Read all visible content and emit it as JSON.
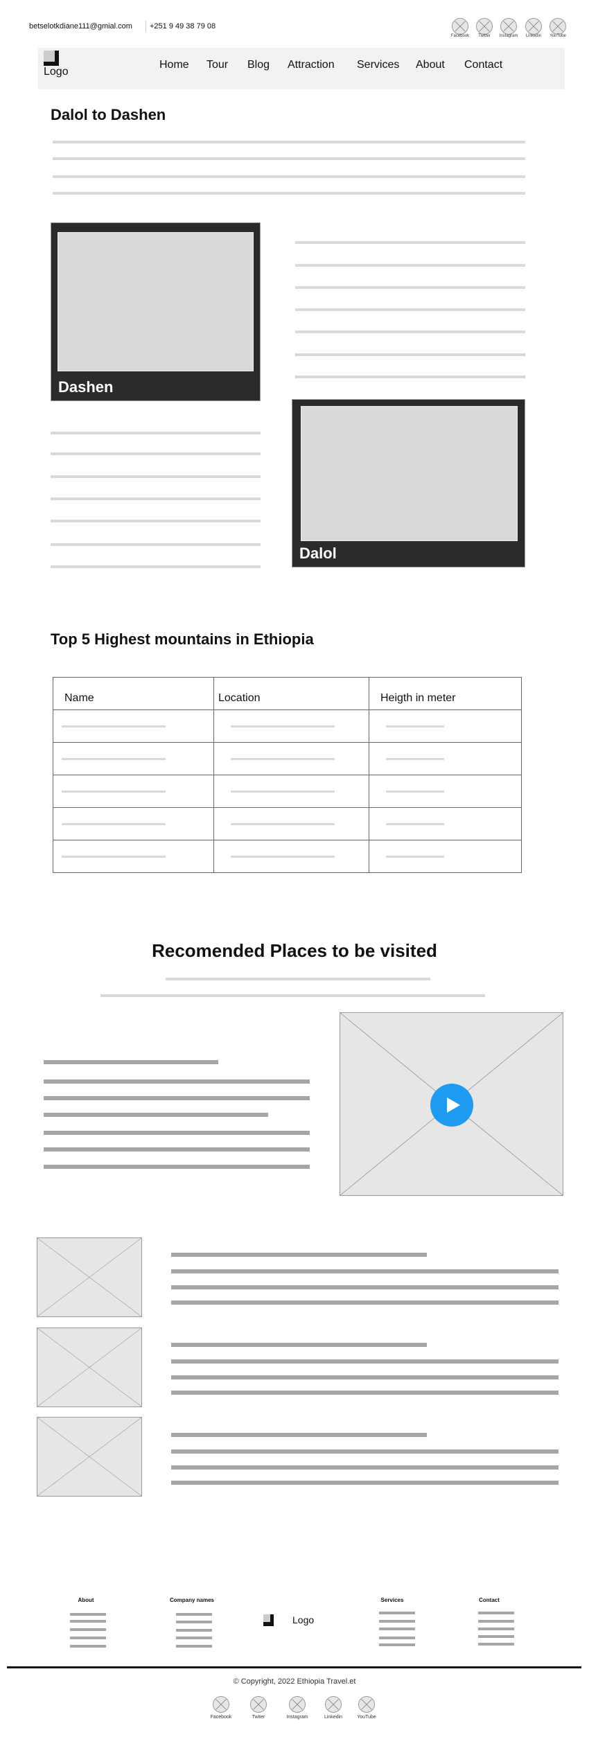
{
  "topbar": {
    "email": "betselotkdiane111@gmial.com",
    "phone": "+251 9 49 38 79 08",
    "social": [
      "Facebook",
      "Twitter",
      "Instagram",
      "Linkedin",
      "YouTube"
    ]
  },
  "nav": {
    "logo": "Logo",
    "items": [
      "Home",
      "Tour",
      "Blog",
      "Attraction",
      "Services",
      "About",
      "Contact"
    ]
  },
  "intro": {
    "title": "Dalol to Dashen",
    "cards": [
      "Dashen",
      "Dalol"
    ]
  },
  "table": {
    "title": "Top 5 Highest mountains in Ethiopia",
    "headers": [
      "Name",
      "Location",
      "Heigth in meter"
    ],
    "row_count": 5
  },
  "recommended": {
    "title": "Recomended Places to be visited",
    "play_color": "#1e9bf0",
    "play_icon": "play-icon"
  },
  "footer": {
    "columns": [
      "About",
      "Company names",
      "Services",
      "Contact"
    ],
    "logo": "Logo",
    "copyright": "© Copyright, 2022 Ethiopia Travel.et",
    "social": [
      "Facebook",
      "Twiter",
      "Instagram",
      "Linkedin",
      "YouTube"
    ]
  }
}
